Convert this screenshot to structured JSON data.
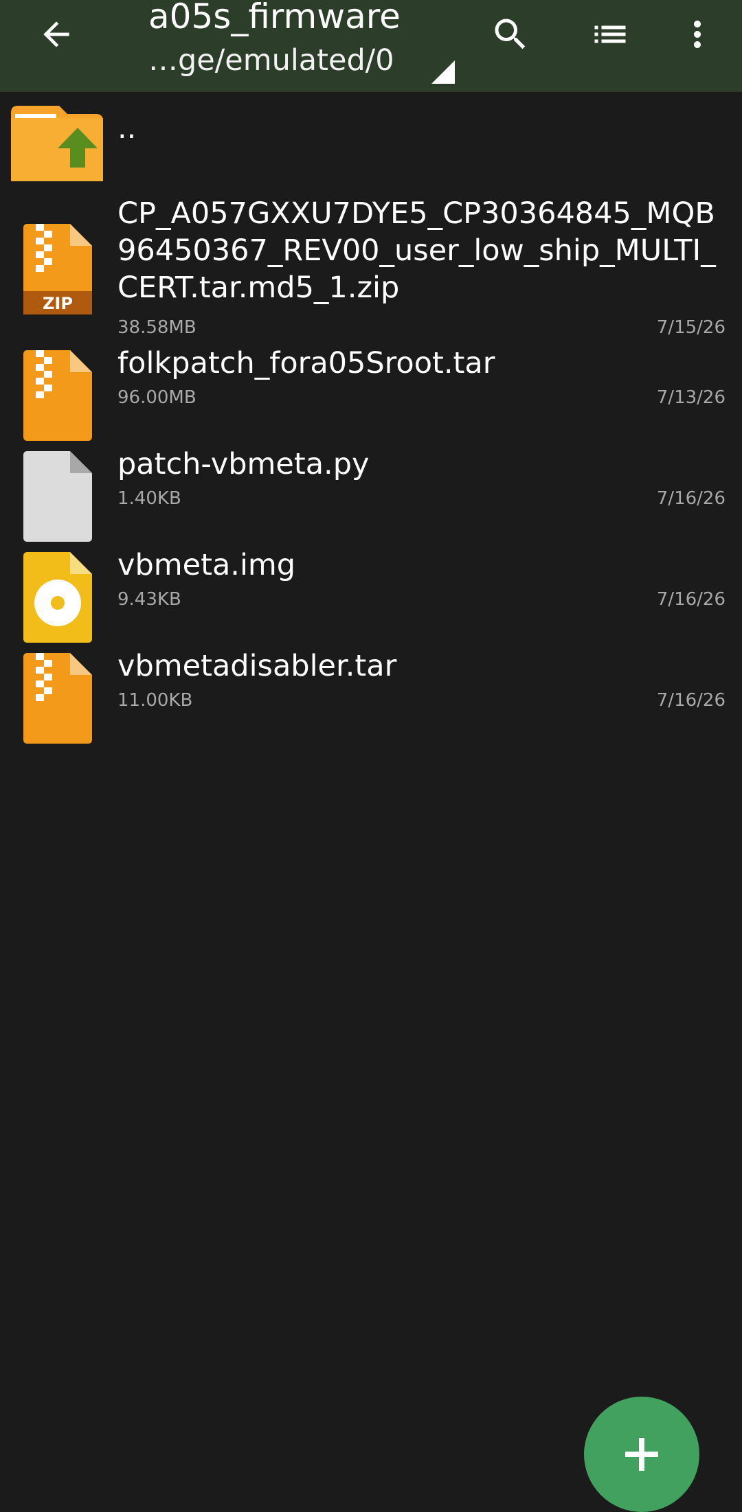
{
  "appbar": {
    "title": "a05s_firmware",
    "path": "…ge/emulated/0",
    "icons": {
      "back": "arrow-left-icon",
      "search": "search-icon",
      "view": "list-view-icon",
      "more": "more-vertical-icon"
    }
  },
  "parent": {
    "label": "..",
    "icon": "folder-up-icon"
  },
  "files": [
    {
      "name": "CP_A057GXXU7DYE5_CP30364845_MQB96450367_REV00_user_low_ship_MULTI_CERT.tar.md5_1.zip",
      "size": "38.58MB",
      "date": "7/15/26",
      "icon": "zip-file-icon"
    },
    {
      "name": "folkpatch_fora05Sroot.tar",
      "size": "96.00MB",
      "date": "7/13/26",
      "icon": "archive-file-icon"
    },
    {
      "name": "patch-vbmeta.py",
      "size": "1.40KB",
      "date": "7/16/26",
      "icon": "generic-file-icon"
    },
    {
      "name": "vbmeta.img",
      "size": "9.43KB",
      "date": "7/16/26",
      "icon": "disk-image-file-icon"
    },
    {
      "name": "vbmetadisabler.tar",
      "size": "11.00KB",
      "date": "7/16/26",
      "icon": "archive-file-icon"
    }
  ],
  "fab": {
    "icon": "plus-icon"
  },
  "colors": {
    "appbar": "#2c3e29",
    "background": "#1b1b1b",
    "archive": "#f39a1a",
    "image": "#f2bd18",
    "fab": "#43a160"
  }
}
